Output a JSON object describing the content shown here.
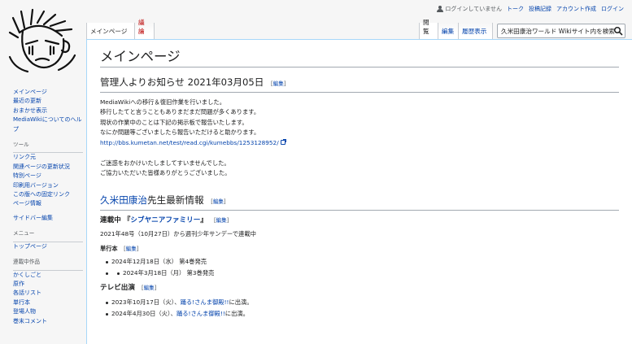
{
  "personal": {
    "not_logged_in": "ログインしていません",
    "talk": "トーク",
    "contributions": "投稿記録",
    "create_account": "アカウント作成",
    "login": "ログイン"
  },
  "tabs": {
    "main_page": "メインページ",
    "talk": "議論",
    "read": "閲覧",
    "edit": "編集",
    "history": "履歴表示"
  },
  "search": {
    "placeholder": "久米田康治ワールド Wikiサイト内を検索"
  },
  "sidebar": {
    "nav": [
      "メインページ",
      "最近の更新",
      "おまかせ表示",
      "MediaWikiについてのヘルプ"
    ],
    "tools_heading": "ツール",
    "tools": [
      "リンク元",
      "関連ページの更新状況",
      "特別ページ",
      "印刷用バージョン",
      "この版への固定リンク",
      "ページ情報"
    ],
    "sidebar_edit": "サイドバー編集",
    "menu_heading": "メニュー",
    "menu": [
      "トップページ"
    ],
    "works_heading": "連載中作品",
    "works": [
      "かくしごと",
      "原作",
      "各話リスト",
      "単行本",
      "登場人物",
      "巻末コメント"
    ]
  },
  "content": {
    "title": "メインページ",
    "edit_label": "編集",
    "notice": {
      "heading": "管理人よりお知らせ 2021年03月05日",
      "lines": [
        "MediaWikiへの移行＆復旧作業を行いました。",
        "移行したてと言うこともありまだまだ問題が多くあります。",
        "現状の作業中のことは下記の掲示板で報告いたします。",
        "なにか問題等ございましたら報告いただけると助かります。"
      ],
      "link": "http://bbs.kumetan.net/test/read.cgi/kumebbs/1253128952/",
      "closing": [
        "ご迷惑をおかけいたしましてすいませんでした。",
        "ご協力いただいた皆様ありがとうございました。"
      ]
    },
    "latest": {
      "heading_link": "久米田康治",
      "heading_rest": "先生最新情報",
      "serial_prefix": "連載中 『",
      "serial_title": "シブヤニアファミリー",
      "serial_suffix": "』",
      "serial_text": "2021年48号（10月27日）から週刊少年サンデーで連載中",
      "volumes_heading": "単行本",
      "volumes": [
        "2024年12月18日（水） 第4巻発売",
        "2024年3月18日（月） 第3巻発売"
      ],
      "tv_heading": "テレビ出演",
      "tv": [
        {
          "date": "2023年10月17日（火）、",
          "show": "踊る!さんま御殿!!",
          "rest": "に出演。"
        },
        {
          "date": "2024年4月30日（火）、",
          "show": "踊る!さんま御殿!!",
          "rest": "に出演。"
        }
      ]
    }
  },
  "colors": {
    "link": "#0645ad",
    "new_link": "#ba0000",
    "border": "#a7d7f9"
  }
}
